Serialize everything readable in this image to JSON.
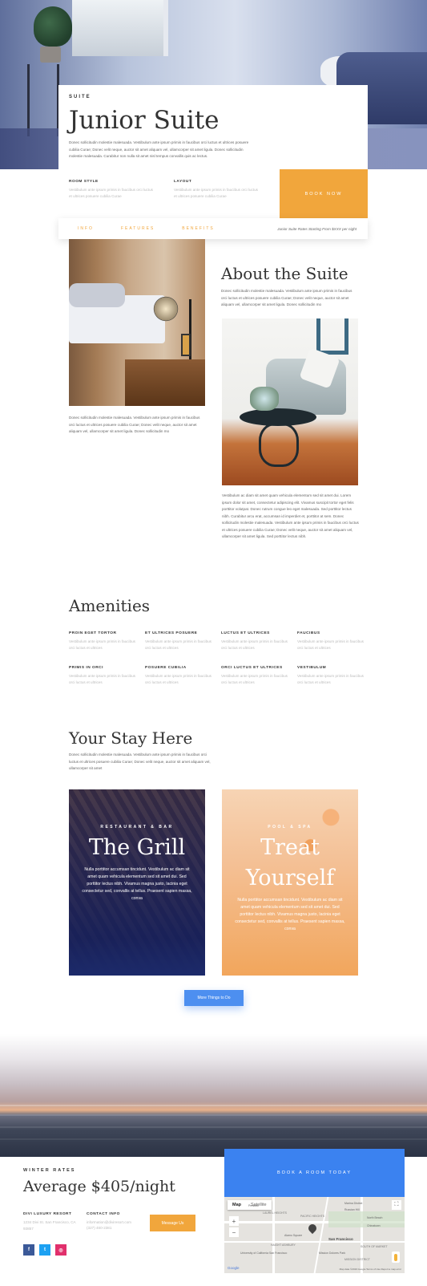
{
  "hero": {
    "eyebrow": "SUITE",
    "title": "Junior Suite",
    "desc": "Donec sollicitudin molestie malesuada. Vestibulum ante ipsum primis in faucibus orci luctus et ultrices posuere cubilia Curae; Donec velit neque, auctor sit amet aliquam vel, ullamcorper sit amet ligula. Donec sollicitudin molestie malesuada. Curabitur non nulla sit amet nisl tempus convallis quis ac lectus.",
    "room_style_label": "ROOM STYLE",
    "room_style_text": "Vestibulum ante ipsum primis in faucibus orci luctus et ultrices posuere cubilia Curae",
    "layout_label": "LAYOUT",
    "layout_text": "Vestibulum ante ipsum primis in faucibus orci luctus et ultrices posuere cubilia Curae",
    "book_now": "BOOK NOW"
  },
  "tabs": {
    "items": [
      "INFO",
      "FEATURES",
      "BENEFITS"
    ],
    "note": "Junior Suite Rates Starting From $XXX per night"
  },
  "about": {
    "title": "About the Suite",
    "intro": "Donec sollicitudin molestie malesuada. Vestibulum ante ipsum primis in faucibus orci luctus et ultrices posuere cubilia Curae; Donec velit neque, auctor sit amet aliquam vel, ullamcorper sit amet ligula. Donec sollicitudin mo",
    "left_text": "Donec sollicitudin molestie malesuada. Vestibulum ante ipsum primis in faucibus orci luctus et ultrices posuere cubilia Curae; Donec velit neque, auctor sit amet aliquam vel, ullamcorper sit amet ligula. Donec sollicitudin mo",
    "right_text": "Vestibulum ac diam sit amet quam vehicula elementum sed sit amet dui. Lorem ipsum dolor sit amet, consectetur adipiscing elit. Vivamus suscipit tortor eget felis porttitor volutpat. Donec rutrum congue leo eget malesuada. Sed porttitor lectus nibh. Curabitur arcu erat, accumsan id imperdiet et, porttitor at sem. Donec sollicitudin molestie malesuada. Vestibulum ante ipsum primis in faucibus orci luctus et ultrices posuere cubilia Curae; Donec velit neque, auctor sit amet aliquam vel, ullamcorper sit amet ligula. Sed porttitor lectus nibh."
  },
  "amenities": {
    "title": "Amenities",
    "items": [
      {
        "label": "PROIN EGET TORTOR",
        "text": "Vestibulum ante ipsum primis in faucibus orci luctus et ultrices"
      },
      {
        "label": "ET ULTRICES POSUERE",
        "text": "Vestibulum ante ipsum primis in faucibus orci luctus et ultrices"
      },
      {
        "label": "LUCTUS ET ULTRICES",
        "text": "Vestibulum ante ipsum primis in faucibus orci luctus et ultrices"
      },
      {
        "label": "FAUCIBUS",
        "text": "Vestibulum ante ipsum primis in faucibus orci luctus et ultrices"
      },
      {
        "label": "PRIMIS IN ORCI",
        "text": "Vestibulum ante ipsum primis in faucibus orci luctus et ultrices"
      },
      {
        "label": "POSUERE CUBILIA",
        "text": "Vestibulum ante ipsum primis in faucibus orci luctus et ultrices"
      },
      {
        "label": "ORCI LUCTUS ET ULTRICES",
        "text": "Vestibulum ante ipsum primis in faucibus orci luctus et ultrices"
      },
      {
        "label": "VESTIBULUM",
        "text": "Vestibulum ante ipsum primis in faucibus orci luctus et ultrices"
      }
    ]
  },
  "stay": {
    "title": "Your Stay Here",
    "intro": "Donec sollicitudin molestie malesuada. Vestibulum ante ipsum primis in faucibus orci luctus et ultrices posuere cubilia Curae; Donec velit neque, auctor sit amet aliquam vel, ullamcorper sit amet",
    "grill": {
      "kicker": "RESTAURANT & BAR",
      "title": "The Grill",
      "desc": "Nulla porttitor accumsan tincidunt. Vestibulum ac diam sit amet quam vehicula elementum sed sit amet dui. Sed porttitor lectus nibh. Vivamus magna justo, lacinia eget consectetur sed, convallis at tellus. Praesent sapien massa, conva"
    },
    "spa": {
      "kicker": "POOL & SPA",
      "title": "Treat Yourself",
      "desc": "Nulla porttitor accumsan tincidunt. Vestibulum ac diam sit amet quam vehicula elementum sed sit amet dui. Sed porttitor lectus nibh. Vivamus magna justo, lacinia eget consectetur sed, convallis at tellus. Praesent sapien massa, conva"
    },
    "more_button": "More Things to Do"
  },
  "footer": {
    "eyebrow": "WINTER RATES",
    "price": "Average $405/night",
    "resort_label": "DIVI LUXURY RESORT",
    "resort_address": "1234 Divi St. San Francisco, CA 93857",
    "contact_label": "CONTACT INFO",
    "contact_email": "information@diviresort.com",
    "contact_phone": "(327) 460-2381",
    "message_button": "Message Us",
    "book_room": "BOOK A ROOM TODAY",
    "map_tab_map": "Map",
    "map_tab_satellite": "Satellite",
    "map_zoom_in": "+",
    "map_zoom_out": "−",
    "map_fullscreen": "⛶",
    "map_labels": [
      "Marina District",
      "Russian Hill",
      "Presidio",
      "North Beach",
      "PACIFIC HEIGHTS",
      "Chinatown",
      "LAUREL HEIGHTS",
      "San Francisco",
      "Alamo Square",
      "SOUTH OF MARKET",
      "University of California San Francisco",
      "HAIGHT ASHBURY",
      "Mission Dolores Park",
      "MISSION DISTRICT",
      "Google"
    ],
    "map_footer": "Map data ©2019 Google   Terms of Use   Report a map error",
    "social": [
      {
        "icon": "facebook-icon",
        "glyph": "f",
        "color": "#3b5998"
      },
      {
        "icon": "twitter-icon",
        "glyph": "t",
        "color": "#1da1f2"
      },
      {
        "icon": "instagram-icon",
        "glyph": "◎",
        "color": "#e1306c"
      }
    ]
  },
  "colors": {
    "accent_orange": "#f1a63c",
    "accent_blue": "#3b82f0"
  }
}
